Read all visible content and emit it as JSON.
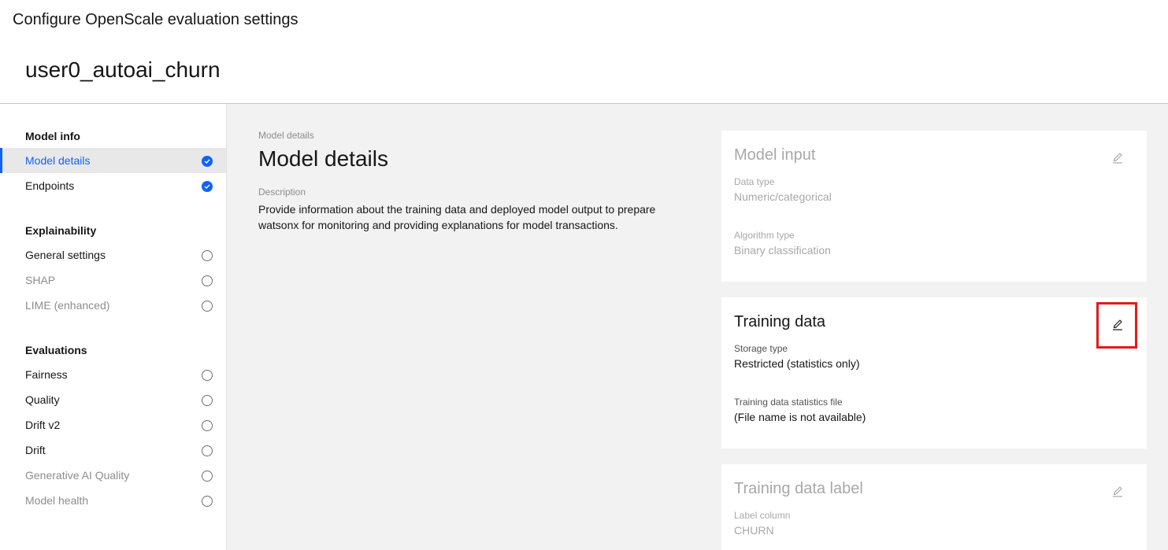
{
  "header": {
    "app_title": "Configure OpenScale evaluation settings",
    "model_name": "user0_autoai_churn"
  },
  "sidebar": {
    "groups": [
      {
        "title": "Model info",
        "items": [
          {
            "label": "Model details",
            "status": "complete"
          },
          {
            "label": "Endpoints",
            "status": "complete"
          }
        ]
      },
      {
        "title": "Explainability",
        "items": [
          {
            "label": "General settings",
            "status": "incomplete"
          },
          {
            "label": "SHAP",
            "status": "incomplete"
          },
          {
            "label": "LIME (enhanced)",
            "status": "incomplete"
          }
        ]
      },
      {
        "title": "Evaluations",
        "items": [
          {
            "label": "Fairness",
            "status": "incomplete"
          },
          {
            "label": "Quality",
            "status": "incomplete"
          },
          {
            "label": "Drift v2",
            "status": "incomplete"
          },
          {
            "label": "Drift",
            "status": "incomplete"
          },
          {
            "label": "Generative AI Quality",
            "status": "incomplete"
          },
          {
            "label": "Model health",
            "status": "incomplete"
          }
        ]
      }
    ]
  },
  "main": {
    "breadcrumb": "Model details",
    "title": "Model details",
    "description_label": "Description",
    "description": "Provide information about the training data and deployed model output to prepare watsonx for monitoring and providing explanations for model transactions."
  },
  "cards": [
    {
      "title": "Model input",
      "fields": [
        {
          "label": "Data type",
          "value": "Numeric/categorical"
        },
        {
          "label": "Algorithm type",
          "value": "Binary classification"
        }
      ]
    },
    {
      "title": "Training data",
      "fields": [
        {
          "label": "Storage type",
          "value": "Restricted (statistics only)"
        },
        {
          "label": "Training data statistics file",
          "value": "(File name is not available)"
        }
      ]
    },
    {
      "title": "Training data label",
      "fields": [
        {
          "label": "Label column",
          "value": "CHURN"
        }
      ]
    }
  ],
  "colors": {
    "accent": "#0f62fe",
    "highlight": "#e11b1b",
    "main_background": "#f2f2f2"
  }
}
